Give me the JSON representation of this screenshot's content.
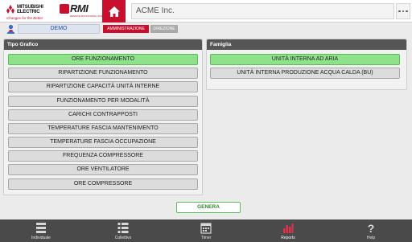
{
  "header": {
    "brand_mitsu_line1": "MITSUBISHI",
    "brand_mitsu_line2": "ELECTRIC",
    "brand_tagline": "Changes for the Better",
    "brand_rmi": "RMI",
    "brand_rmi_sub": "REMOTE MONITORING INTERFACE",
    "company": "ACME Inc.",
    "home_icon": "home-icon",
    "more_icon": "more-dots-icon"
  },
  "user": {
    "icon": "user-icon",
    "name": "DEMO",
    "tabs": [
      {
        "label": "AMMINISTRAZIONE",
        "active": true
      },
      {
        "label": "DIREZIONE",
        "active": false
      }
    ]
  },
  "panel_left": {
    "title": "Tipo Grafico",
    "options": [
      {
        "label": "ORE FUNZIONAMENTO",
        "selected": true
      },
      {
        "label": "RIPARTIZIONE FUNZIONAMENTO",
        "selected": false
      },
      {
        "label": "RIPARTIZIONE CAPACITÀ UNITÀ INTERNE",
        "selected": false
      },
      {
        "label": "FUNZIONAMENTO PER MODALITÀ",
        "selected": false
      },
      {
        "label": "CARICHI CONTRAPPOSTI",
        "selected": false
      },
      {
        "label": "TEMPERATURE FASCIA MANTENIMENTO",
        "selected": false
      },
      {
        "label": "TEMPERATURE FASCIA OCCUPAZIONE",
        "selected": false
      },
      {
        "label": "FREQUENZA COMPRESSORE",
        "selected": false
      },
      {
        "label": "ORE VENTILATORE",
        "selected": false
      },
      {
        "label": "ORE COMPRESSORE",
        "selected": false
      }
    ]
  },
  "panel_right": {
    "title": "Famiglia",
    "options": [
      {
        "label": "UNITÀ INTERNA AD ARIA",
        "selected": true
      },
      {
        "label": "UNITÀ INTERNA PRODUZIONE ACQUA CALDA (BU)",
        "selected": false
      }
    ]
  },
  "genera_label": "GENERA",
  "bottom_nav": [
    {
      "label": "Individuale",
      "icon": "list-icon",
      "active": false
    },
    {
      "label": "Collettivo",
      "icon": "collective-list-icon",
      "active": false
    },
    {
      "label": "Timer",
      "icon": "calendar-icon",
      "active": false
    },
    {
      "label": "Reports",
      "icon": "bar-chart-icon",
      "active": true
    },
    {
      "label": "Help",
      "icon": "help-icon",
      "active": false
    }
  ],
  "colors": {
    "brand_red": "#c8102e",
    "selected_green": "#8ee38a",
    "active_report_red": "#e0314a"
  }
}
